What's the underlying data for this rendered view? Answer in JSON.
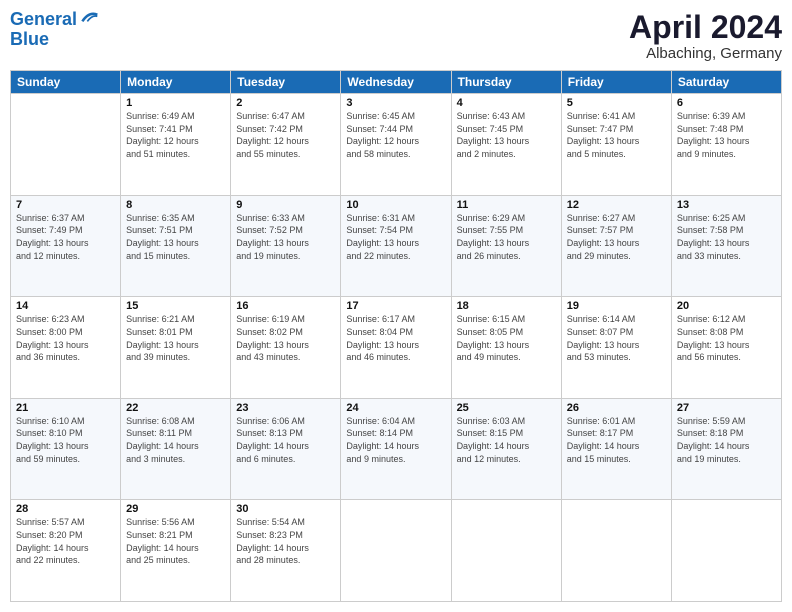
{
  "logo": {
    "line1": "General",
    "line2": "Blue"
  },
  "title": "April 2024",
  "location": "Albaching, Germany",
  "weekdays": [
    "Sunday",
    "Monday",
    "Tuesday",
    "Wednesday",
    "Thursday",
    "Friday",
    "Saturday"
  ],
  "weeks": [
    [
      {
        "day": "",
        "info": ""
      },
      {
        "day": "1",
        "info": "Sunrise: 6:49 AM\nSunset: 7:41 PM\nDaylight: 12 hours\nand 51 minutes."
      },
      {
        "day": "2",
        "info": "Sunrise: 6:47 AM\nSunset: 7:42 PM\nDaylight: 12 hours\nand 55 minutes."
      },
      {
        "day": "3",
        "info": "Sunrise: 6:45 AM\nSunset: 7:44 PM\nDaylight: 12 hours\nand 58 minutes."
      },
      {
        "day": "4",
        "info": "Sunrise: 6:43 AM\nSunset: 7:45 PM\nDaylight: 13 hours\nand 2 minutes."
      },
      {
        "day": "5",
        "info": "Sunrise: 6:41 AM\nSunset: 7:47 PM\nDaylight: 13 hours\nand 5 minutes."
      },
      {
        "day": "6",
        "info": "Sunrise: 6:39 AM\nSunset: 7:48 PM\nDaylight: 13 hours\nand 9 minutes."
      }
    ],
    [
      {
        "day": "7",
        "info": "Sunrise: 6:37 AM\nSunset: 7:49 PM\nDaylight: 13 hours\nand 12 minutes."
      },
      {
        "day": "8",
        "info": "Sunrise: 6:35 AM\nSunset: 7:51 PM\nDaylight: 13 hours\nand 15 minutes."
      },
      {
        "day": "9",
        "info": "Sunrise: 6:33 AM\nSunset: 7:52 PM\nDaylight: 13 hours\nand 19 minutes."
      },
      {
        "day": "10",
        "info": "Sunrise: 6:31 AM\nSunset: 7:54 PM\nDaylight: 13 hours\nand 22 minutes."
      },
      {
        "day": "11",
        "info": "Sunrise: 6:29 AM\nSunset: 7:55 PM\nDaylight: 13 hours\nand 26 minutes."
      },
      {
        "day": "12",
        "info": "Sunrise: 6:27 AM\nSunset: 7:57 PM\nDaylight: 13 hours\nand 29 minutes."
      },
      {
        "day": "13",
        "info": "Sunrise: 6:25 AM\nSunset: 7:58 PM\nDaylight: 13 hours\nand 33 minutes."
      }
    ],
    [
      {
        "day": "14",
        "info": "Sunrise: 6:23 AM\nSunset: 8:00 PM\nDaylight: 13 hours\nand 36 minutes."
      },
      {
        "day": "15",
        "info": "Sunrise: 6:21 AM\nSunset: 8:01 PM\nDaylight: 13 hours\nand 39 minutes."
      },
      {
        "day": "16",
        "info": "Sunrise: 6:19 AM\nSunset: 8:02 PM\nDaylight: 13 hours\nand 43 minutes."
      },
      {
        "day": "17",
        "info": "Sunrise: 6:17 AM\nSunset: 8:04 PM\nDaylight: 13 hours\nand 46 minutes."
      },
      {
        "day": "18",
        "info": "Sunrise: 6:15 AM\nSunset: 8:05 PM\nDaylight: 13 hours\nand 49 minutes."
      },
      {
        "day": "19",
        "info": "Sunrise: 6:14 AM\nSunset: 8:07 PM\nDaylight: 13 hours\nand 53 minutes."
      },
      {
        "day": "20",
        "info": "Sunrise: 6:12 AM\nSunset: 8:08 PM\nDaylight: 13 hours\nand 56 minutes."
      }
    ],
    [
      {
        "day": "21",
        "info": "Sunrise: 6:10 AM\nSunset: 8:10 PM\nDaylight: 13 hours\nand 59 minutes."
      },
      {
        "day": "22",
        "info": "Sunrise: 6:08 AM\nSunset: 8:11 PM\nDaylight: 14 hours\nand 3 minutes."
      },
      {
        "day": "23",
        "info": "Sunrise: 6:06 AM\nSunset: 8:13 PM\nDaylight: 14 hours\nand 6 minutes."
      },
      {
        "day": "24",
        "info": "Sunrise: 6:04 AM\nSunset: 8:14 PM\nDaylight: 14 hours\nand 9 minutes."
      },
      {
        "day": "25",
        "info": "Sunrise: 6:03 AM\nSunset: 8:15 PM\nDaylight: 14 hours\nand 12 minutes."
      },
      {
        "day": "26",
        "info": "Sunrise: 6:01 AM\nSunset: 8:17 PM\nDaylight: 14 hours\nand 15 minutes."
      },
      {
        "day": "27",
        "info": "Sunrise: 5:59 AM\nSunset: 8:18 PM\nDaylight: 14 hours\nand 19 minutes."
      }
    ],
    [
      {
        "day": "28",
        "info": "Sunrise: 5:57 AM\nSunset: 8:20 PM\nDaylight: 14 hours\nand 22 minutes."
      },
      {
        "day": "29",
        "info": "Sunrise: 5:56 AM\nSunset: 8:21 PM\nDaylight: 14 hours\nand 25 minutes."
      },
      {
        "day": "30",
        "info": "Sunrise: 5:54 AM\nSunset: 8:23 PM\nDaylight: 14 hours\nand 28 minutes."
      },
      {
        "day": "",
        "info": ""
      },
      {
        "day": "",
        "info": ""
      },
      {
        "day": "",
        "info": ""
      },
      {
        "day": "",
        "info": ""
      }
    ]
  ]
}
